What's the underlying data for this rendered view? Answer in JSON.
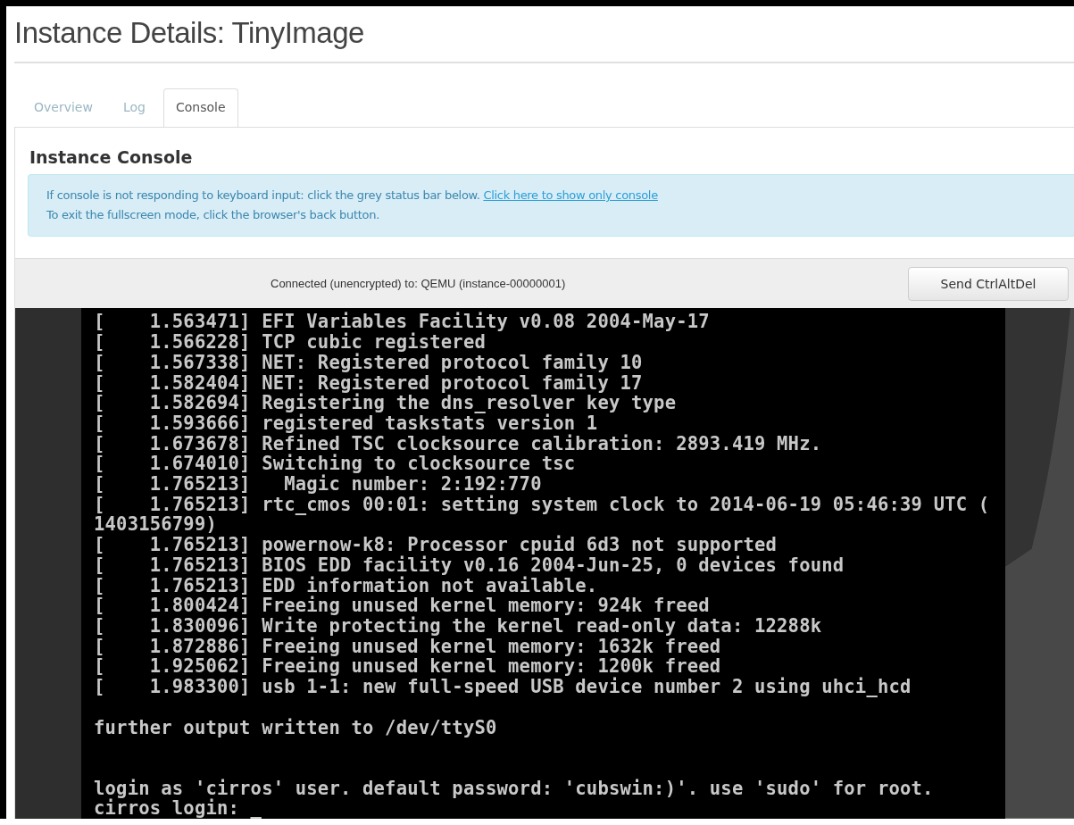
{
  "page": {
    "title": "Instance Details: TinyImage"
  },
  "tabs": [
    {
      "label": "Overview",
      "selected": false
    },
    {
      "label": "Log",
      "selected": false
    },
    {
      "label": "Console",
      "selected": true
    }
  ],
  "console_panel": {
    "heading": "Instance Console",
    "info": {
      "text": "If console is not responding to keyboard input: click the grey status bar below.",
      "link": "Click here to show only console",
      "second_line": "To exit the fullscreen mode, click the browser's back button."
    },
    "status_bar": {
      "text": "Connected (unencrypted) to: QEMU (instance-00000001)",
      "button": "Send CtrlAltDel"
    },
    "terminal": {
      "blocks": [
        {
          "kind": "kernel-log",
          "lines": [
            "[    1.563471] EFI Variables Facility v0.08 2004-May-17",
            "[    1.566228] TCP cubic registered",
            "[    1.567338] NET: Registered protocol family 10",
            "[    1.582404] NET: Registered protocol family 17",
            "[    1.582694] Registering the dns_resolver key type",
            "[    1.593666] registered taskstats version 1",
            "[    1.673678] Refined TSC clocksource calibration: 2893.419 MHz.",
            "[    1.674010] Switching to clocksource tsc",
            "[    1.765213]   Magic number: 2:192:770",
            "[    1.765213] rtc_cmos 00:01: setting system clock to 2014-06-19 05:46:39 UTC (",
            "1403156799)",
            "[    1.765213] powernow-k8: Processor cpuid 6d3 not supported",
            "[    1.765213] BIOS EDD facility v0.16 2004-Jun-25, 0 devices found",
            "[    1.765213] EDD information not available.",
            "[    1.800424] Freeing unused kernel memory: 924k freed",
            "[    1.830096] Write protecting the kernel read-only data: 12288k",
            "[    1.872886] Freeing unused kernel memory: 1632k freed",
            "[    1.925062] Freeing unused kernel memory: 1200k freed",
            "[    1.983300] usb 1-1: new full-speed USB device number 2 using uhci_hcd"
          ]
        },
        {
          "kind": "notice",
          "lines": [
            "further output written to /dev/ttyS0"
          ]
        },
        {
          "kind": "login",
          "lines": [
            "login as 'cirros' user. default password: 'cubswin:)'. use 'sudo' for root.",
            "cirros login: _"
          ]
        }
      ]
    }
  }
}
